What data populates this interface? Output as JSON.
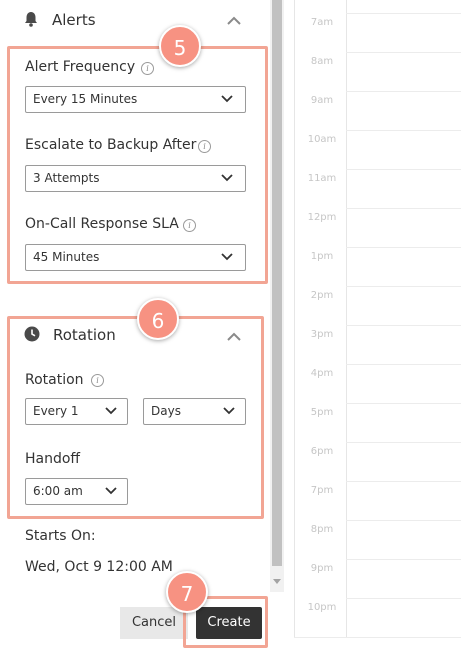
{
  "alerts": {
    "title": "Alerts",
    "step": "5",
    "fields": [
      {
        "label": "Alert Frequency",
        "value": "Every 15 Minutes"
      },
      {
        "label": "Escalate to Backup After",
        "value": "3 Attempts"
      },
      {
        "label": "On-Call Response SLA",
        "value": "45 Minutes"
      }
    ]
  },
  "rotation": {
    "title": "Rotation",
    "step": "6",
    "rotation_label": "Rotation",
    "every_value": "Every 1",
    "unit_value": "Days",
    "handoff_label": "Handoff",
    "handoff_value": "6:00 am"
  },
  "starts": {
    "label": "Starts On:",
    "value": "Wed, Oct 9 12:00 AM"
  },
  "actions": {
    "cancel_label": "Cancel",
    "create_label": "Create",
    "step": "7"
  },
  "calendar": {
    "hours": [
      "7am",
      "8am",
      "9am",
      "10am",
      "11am",
      "12pm",
      "1pm",
      "2pm",
      "3pm",
      "4pm",
      "5pm",
      "6pm",
      "7pm",
      "8pm",
      "9pm",
      "10pm"
    ]
  },
  "info_glyph": "i",
  "colors": {
    "highlight": "#f2a594",
    "badge": "#f79282",
    "create_bg": "#333333",
    "cancel_bg": "#e8e8e8"
  }
}
